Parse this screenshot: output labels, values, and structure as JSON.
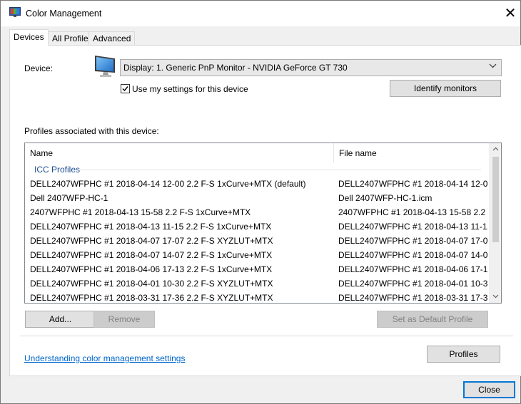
{
  "window": {
    "title": "Color Management",
    "close_glyph": "✕"
  },
  "tabs": [
    {
      "label": "Devices",
      "active": true
    },
    {
      "label": "All Profiles",
      "active": false
    },
    {
      "label": "Advanced",
      "active": false
    }
  ],
  "device": {
    "label": "Device:",
    "icon": "monitor-icon",
    "selected": "Display: 1. Generic PnP Monitor - NVIDIA GeForce GT 730",
    "checkbox_label": "Use my settings for this device",
    "checkbox_checked": true,
    "identify_button": "Identify monitors"
  },
  "profiles": {
    "heading": "Profiles associated with this device:",
    "columns": [
      "Name",
      "File name"
    ],
    "group": "ICC Profiles",
    "rows": [
      {
        "name": "DELL2407WFPHC #1 2018-04-14 12-00 2.2 F-S 1xCurve+MTX (default)",
        "file": "DELL2407WFPHC #1 2018-04-14 12-0..."
      },
      {
        "name": "Dell 2407WFP-HC-1",
        "file": "Dell 2407WFP-HC-1.icm"
      },
      {
        "name": "2407WFPHC #1 2018-04-13 15-58 2.2 F-S 1xCurve+MTX",
        "file": "2407WFPHC #1 2018-04-13 15-58 2.2 ..."
      },
      {
        "name": "DELL2407WFPHC #1 2018-04-13 11-15 2.2 F-S 1xCurve+MTX",
        "file": "DELL2407WFPHC #1 2018-04-13 11-1..."
      },
      {
        "name": "DELL2407WFPHC #1 2018-04-07 17-07 2.2 F-S XYZLUT+MTX",
        "file": "DELL2407WFPHC #1 2018-04-07 17-0..."
      },
      {
        "name": "DELL2407WFPHC #1 2018-04-07 14-07 2.2 F-S 1xCurve+MTX",
        "file": "DELL2407WFPHC #1 2018-04-07 14-0..."
      },
      {
        "name": "DELL2407WFPHC #1 2018-04-06 17-13 2.2 F-S 1xCurve+MTX",
        "file": "DELL2407WFPHC #1 2018-04-06 17-1..."
      },
      {
        "name": "DELL2407WFPHC #1 2018-04-01 10-30 2.2 F-S XYZLUT+MTX",
        "file": "DELL2407WFPHC #1 2018-04-01 10-3..."
      },
      {
        "name": "DELL2407WFPHC #1 2018-03-31 17-36 2.2 F-S XYZLUT+MTX",
        "file": "DELL2407WFPHC #1 2018-03-31 17-3..."
      }
    ]
  },
  "buttons": {
    "add": "Add...",
    "remove": "Remove",
    "set_default": "Set as Default Profile",
    "profiles": "Profiles",
    "close": "Close"
  },
  "link": "Understanding color management settings",
  "colors": {
    "accent": "#0078d7",
    "link": "#0066cc",
    "group_label": "#1e4e8c"
  }
}
